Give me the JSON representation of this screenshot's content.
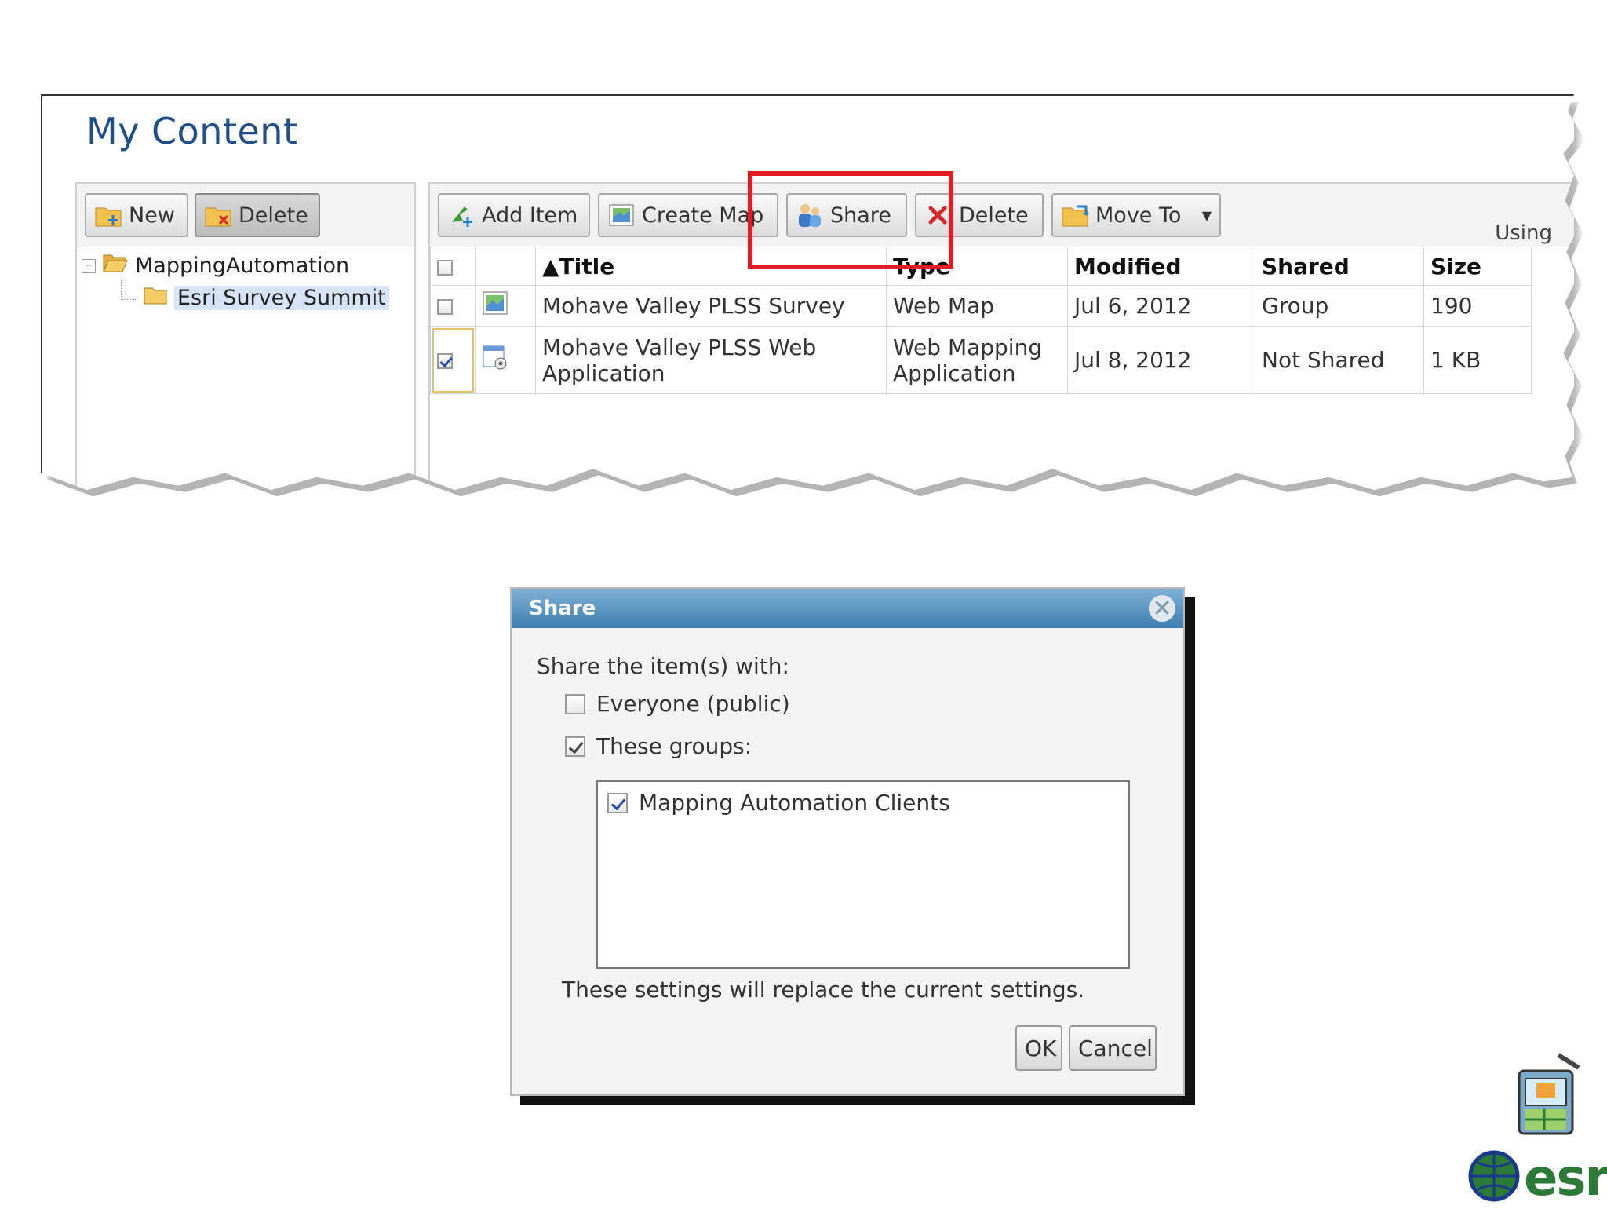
{
  "page": {
    "title": "My Content"
  },
  "folder_pane": {
    "new_label": "New",
    "delete_label": "Delete",
    "tree": [
      {
        "label": "MappingAutomation",
        "expander": "−"
      },
      {
        "label": "Esri Survey Summit"
      }
    ]
  },
  "content_pane": {
    "toolbar": {
      "add_item_label": "Add Item",
      "create_map_label": "Create Map",
      "share_label": "Share",
      "delete_label": "Delete",
      "move_to_label": "Move To",
      "usage_label": "Using"
    },
    "table": {
      "columns": {
        "title": "▲Title",
        "type": "Type",
        "modified": "Modified",
        "shared": "Shared",
        "size": "Size"
      },
      "rows": [
        {
          "checked": false,
          "title": "Mohave Valley PLSS Survey",
          "type": "Web Map",
          "modified": "Jul 6, 2012",
          "shared": "Group",
          "size": "190"
        },
        {
          "checked": true,
          "title": "Mohave Valley PLSS Web Application",
          "type_line1": "Web Mapping",
          "type_line2": "Application",
          "modified": "Jul 8, 2012",
          "shared": "Not Shared",
          "size": "1 KB"
        }
      ]
    }
  },
  "dialog": {
    "title": "Share",
    "prompt": "Share the item(s) with:",
    "everyone_label": "Everyone (public)",
    "everyone_checked": false,
    "groups_label": "These groups:",
    "groups_checked": true,
    "groups": [
      {
        "label": "Mapping Automation Clients",
        "checked": true
      }
    ],
    "note": "These settings will replace the current settings.",
    "ok_label": "OK",
    "cancel_label": "Cancel"
  },
  "logo": {
    "text": "esri"
  },
  "colors": {
    "title_blue": "#1f4f86",
    "link_blue": "#1d6fa8",
    "highlight_red": "#e31b23",
    "dialog_header": "#3f7fb0",
    "logo_green": "#2d7a38"
  },
  "icons": {
    "new": "folder-add-icon",
    "delete_folder": "folder-delete-icon",
    "add_item": "add-item-icon",
    "create_map": "map-icon",
    "share": "share-users-icon",
    "delete": "delete-x-icon",
    "move_to": "move-folder-icon",
    "row1": "web-map-icon",
    "row2": "web-app-icon"
  }
}
